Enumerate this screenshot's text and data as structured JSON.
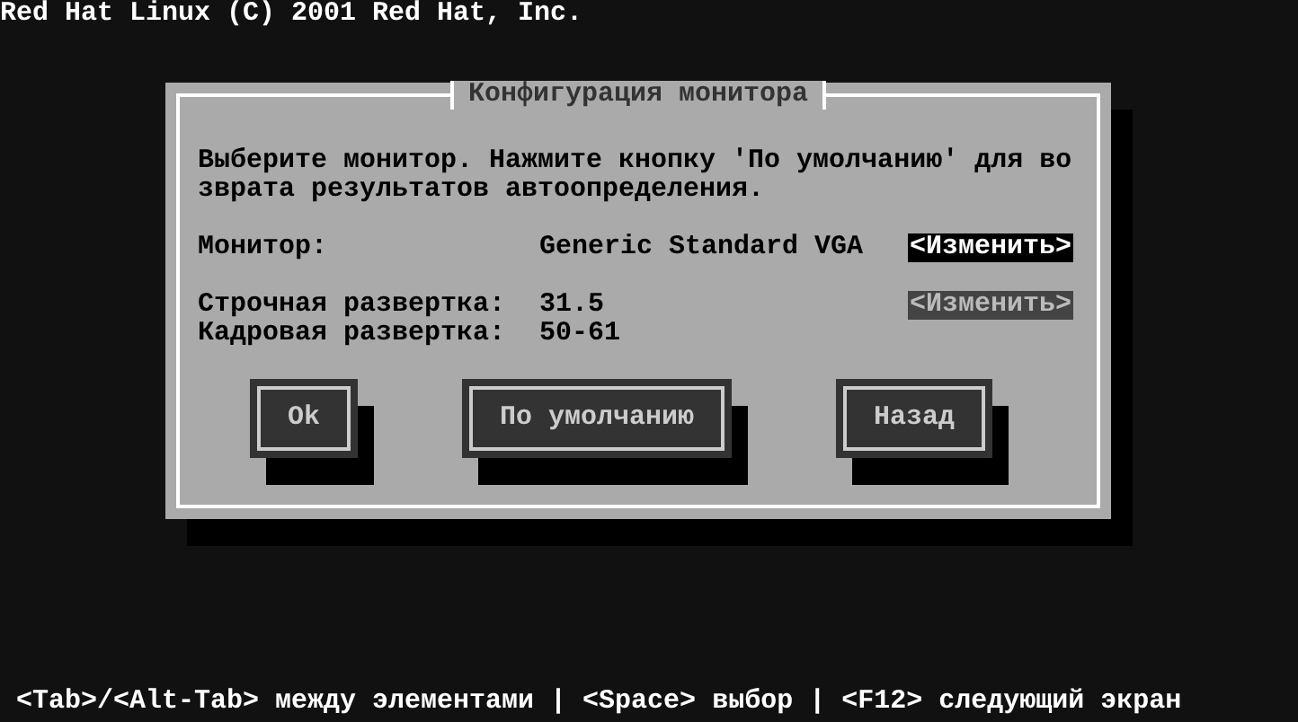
{
  "screen_title": "Red Hat Linux (C) 2001 Red Hat, Inc.",
  "dialog": {
    "title": "Конфигурация монитора",
    "message": "Выберите монитор. Нажмите кнопку 'По умолчанию' для возврата результатов автоопределения.",
    "groups": [
      [
        {
          "label": "Монитор:",
          "value": "Generic Standard VGA",
          "button": {
            "label": "<Изменить>",
            "focused": true
          }
        }
      ],
      [
        {
          "label": "Строчная развертка:",
          "value": "31.5",
          "button": {
            "label": "<Изменить>",
            "focused": false
          }
        },
        {
          "label": "Кадровая развертка:",
          "value": "50-61"
        }
      ]
    ],
    "buttons": [
      "Ok",
      "По умолчанию",
      "Назад"
    ]
  },
  "help_line": "<Tab>/<Alt-Tab> между элементами | <Space> выбор | <F12> следующий экран"
}
